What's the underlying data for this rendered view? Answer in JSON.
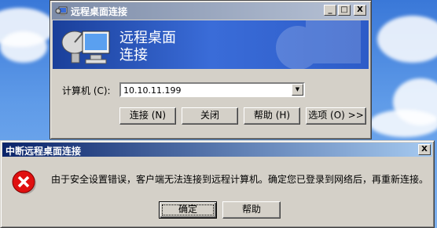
{
  "rdc_window": {
    "title": "远程桌面连接",
    "banner_line1": "远程桌面",
    "banner_line2": "连接",
    "computer_label": "计算机 (C):",
    "computer_value": "10.10.11.199",
    "buttons": {
      "connect": "连接 (N)",
      "close": "关闭",
      "help": "帮助 (H)",
      "options": "选项 (O) >>"
    },
    "controls": {
      "minimize": "_",
      "maximize": "□",
      "close": "X"
    }
  },
  "error_dialog": {
    "title": "中断远程桌面连接",
    "message": "由于安全设置错误，客户端无法连接到远程计算机。确定您已登录到网络后，再重新连接。",
    "ok_label": "确定",
    "help_label": "帮助",
    "close": "X"
  }
}
